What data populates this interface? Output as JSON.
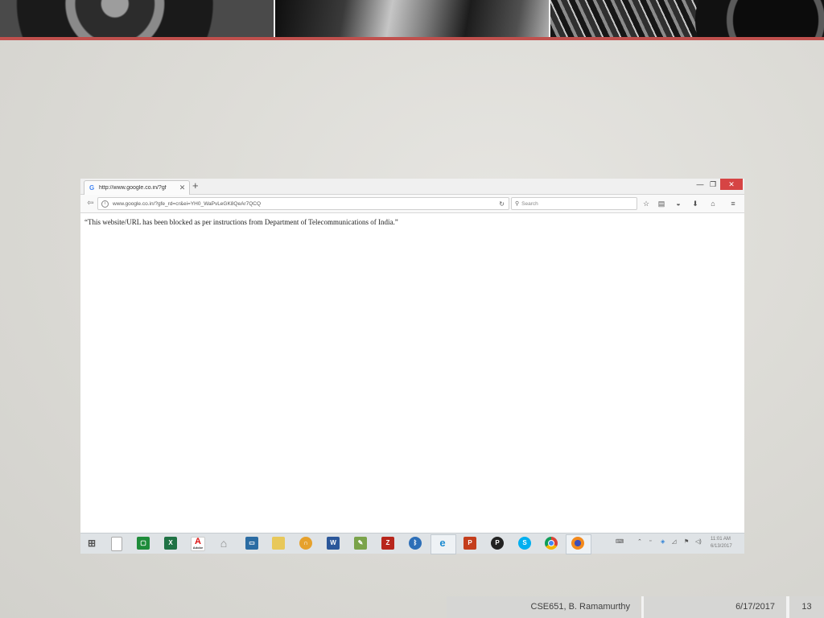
{
  "slide": {
    "footer_author": "CSE651, B. Ramamurthy",
    "footer_date": "6/17/2017",
    "slide_number": "13",
    "accent_color": "#c0504d"
  },
  "browser": {
    "tab_title": "http://www.google.co.in/?gf",
    "tab_close": "✕",
    "new_tab": "+",
    "window_min": "—",
    "window_max": "❐",
    "window_close": "✕",
    "url": "www.google.co.in/?gfe_rd=cr&ei=YH0_WaPvLeGK8QeAr7QCQ",
    "search_placeholder": "Search",
    "toolbar_icons": [
      "star-icon",
      "reader-icon",
      "pocket-icon",
      "download-icon",
      "home-icon",
      "menu-icon"
    ],
    "page_message": "“This website/URL has been blocked as per instructions from Department of Telecommunications of India.”"
  },
  "taskbar": {
    "icons": [
      "windows-start-icon",
      "file-icon",
      "camtasia-icon",
      "excel-icon",
      "adobe-icon",
      "home-icon",
      "monitor-icon",
      "folder-icon",
      "headphones-icon",
      "word-icon",
      "paint-icon",
      "filezilla-icon",
      "bluetooth-icon",
      "internet-explorer-icon",
      "powerpoint-icon",
      "p-app-icon",
      "skype-icon",
      "chrome-icon",
      "firefox-icon"
    ],
    "adobe_label": "Adobe",
    "clock_time": "11:01 AM",
    "clock_date": "6/13/2017"
  }
}
